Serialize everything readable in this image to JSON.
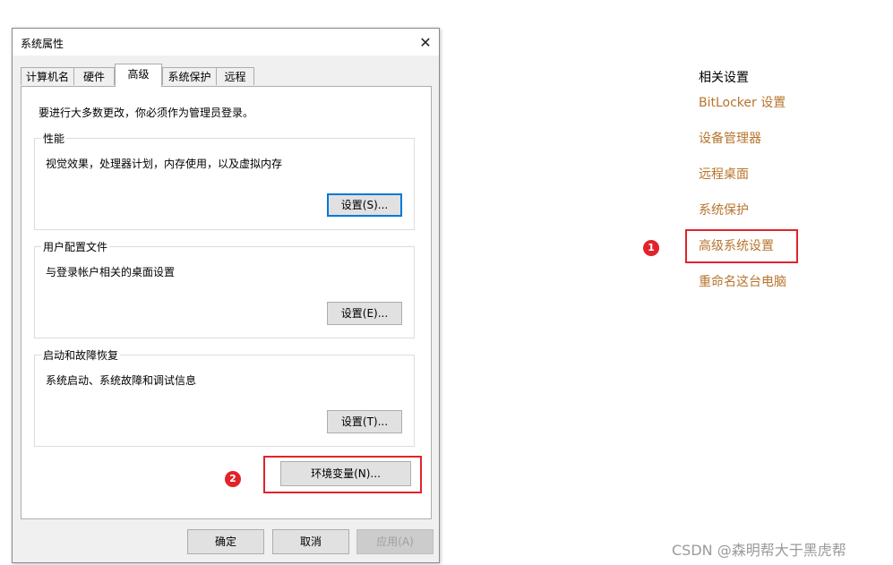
{
  "dialog": {
    "title": "系统属性",
    "close_symbol": "✕",
    "tabs": [
      {
        "label": "计算机名",
        "active": false
      },
      {
        "label": "硬件",
        "active": false
      },
      {
        "label": "高级",
        "active": true
      },
      {
        "label": "系统保护",
        "active": false
      },
      {
        "label": "远程",
        "active": false
      }
    ],
    "admin_note": "要进行大多数更改，你必须作为管理员登录。",
    "groups": [
      {
        "title": "性能",
        "description": "视觉效果，处理器计划，内存使用，以及虚拟内存",
        "button": "设置(S)..."
      },
      {
        "title": "用户配置文件",
        "description": "与登录帐户相关的桌面设置",
        "button": "设置(E)..."
      },
      {
        "title": "启动和故障恢复",
        "description": "系统启动、系统故障和调试信息",
        "button": "设置(T)..."
      }
    ],
    "env_button": "环境变量(N)...",
    "footer": {
      "ok": "确定",
      "cancel": "取消",
      "apply": "应用(A)"
    }
  },
  "related": {
    "title": "相关设置",
    "links": [
      "BitLocker 设置",
      "设备管理器",
      "远程桌面",
      "系统保护",
      "高级系统设置",
      "重命名这台电脑"
    ]
  },
  "markers": [
    "1",
    "2"
  ],
  "watermark": "CSDN @森明帮大于黑虎帮",
  "colors": {
    "link": "#b7742d",
    "highlight": "#e0242b",
    "focus": "#0078d7"
  }
}
